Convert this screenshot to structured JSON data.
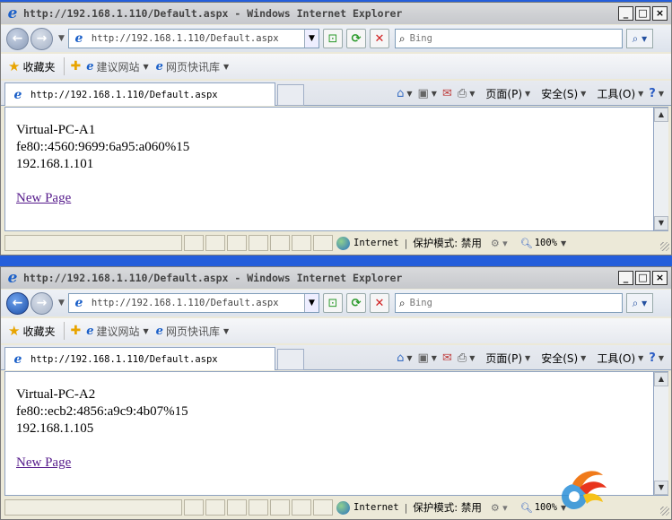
{
  "windows": [
    {
      "title": "http://192.168.1.110/Default.aspx - Windows Internet Explorer",
      "active": false,
      "address": "http://192.168.1.110/Default.aspx",
      "search_placeholder": "Bing",
      "favorites_label": "收藏夹",
      "fav_links": [
        "建议网站",
        "网页快讯库"
      ],
      "tab_label": "http://192.168.1.110/Default.aspx",
      "commands": {
        "page": "页面(P)",
        "safety": "安全(S)",
        "tools": "工具(O)"
      },
      "content": {
        "hostname": "Virtual-PC-A1",
        "ipv6": "fe80::4560:9699:6a95:a060%15",
        "ipv4": "192.168.1.101",
        "link": "New Page"
      },
      "status": {
        "zone": "Internet",
        "protected_mode": "保护模式: 禁用",
        "zoom": "100%"
      }
    },
    {
      "title": "http://192.168.1.110/Default.aspx - Windows Internet Explorer",
      "active": true,
      "address": "http://192.168.1.110/Default.aspx",
      "search_placeholder": "Bing",
      "favorites_label": "收藏夹",
      "fav_links": [
        "建议网站",
        "网页快讯库"
      ],
      "tab_label": "http://192.168.1.110/Default.aspx",
      "commands": {
        "page": "页面(P)",
        "safety": "安全(S)",
        "tools": "工具(O)"
      },
      "content": {
        "hostname": "Virtual-PC-A2",
        "ipv6": "fe80::ecb2:4856:a9c9:4b07%15",
        "ipv4": "192.168.1.105",
        "link": "New Page"
      },
      "status": {
        "zone": "Internet",
        "protected_mode": "保护模式: 禁用",
        "zoom": "100%"
      }
    }
  ],
  "colors": {
    "visited_link": "#551a8b",
    "ie_blue": "#1a5fc8",
    "desktop": "#245edb"
  }
}
